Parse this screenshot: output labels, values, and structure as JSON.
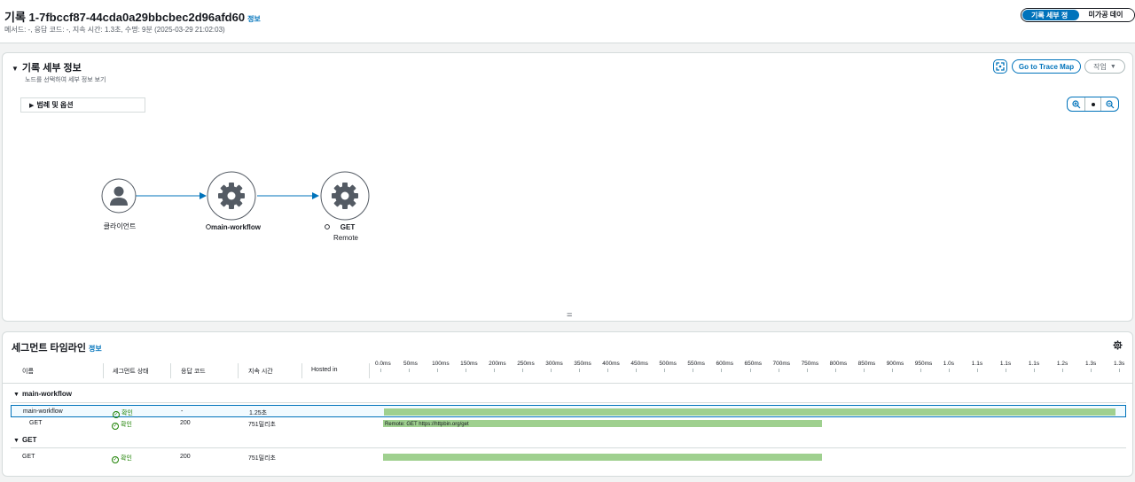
{
  "header": {
    "title": "기록 1-7fbccf87-44cda0a29bbcbec2d96afd60",
    "info": "정보",
    "subtitle": "메서드: -, 응답 코드: -, 지속 시간: 1.3초, 수명: 9분 (2025-03-29 21:02:03)",
    "tabs": [
      "기록 세부 정보",
      "미가공 데이터"
    ]
  },
  "details": {
    "title": "기록 세부 정보",
    "desc": "노드를 선택하여 세부 정보 보기",
    "go_to_trace_map": "Go to Trace Map",
    "actions": "작업",
    "legend_label": "범례 및 옵션",
    "nodes": [
      {
        "label": "클라이언트",
        "sub": ""
      },
      {
        "label": "main-workflow",
        "sub": ""
      },
      {
        "label": "GET",
        "sub": "Remote"
      }
    ],
    "divider": "="
  },
  "timeline": {
    "title": "세그먼트 타임라인",
    "info": "정보",
    "columns": [
      "이름",
      "세그먼트 상태",
      "응답 코드",
      "지속 시간",
      "Hosted in"
    ],
    "ticks": [
      "0.0ms",
      "50ms",
      "100ms",
      "150ms",
      "200ms",
      "250ms",
      "300ms",
      "350ms",
      "400ms",
      "450ms",
      "500ms",
      "550ms",
      "600ms",
      "650ms",
      "700ms",
      "750ms",
      "800ms",
      "850ms",
      "900ms",
      "950ms",
      "1.0s",
      "1.1s",
      "1.1s",
      "1.1s",
      "1.2s",
      "1.3s",
      "1.3s"
    ],
    "groups": [
      {
        "name": "main-workflow",
        "rows": [
          {
            "name": "main-workflow",
            "status": "확인",
            "code": "-",
            "duration": "1.25초",
            "bar_frac": 1.0,
            "bar_label": ""
          },
          {
            "name": "GET",
            "status": "확인",
            "code": "200",
            "duration": "751밀리초",
            "bar_frac": 0.6,
            "bar_label": "Remote: GET https://httpbin.org/get"
          }
        ]
      },
      {
        "name": "GET",
        "rows": [
          {
            "name": "GET",
            "status": "확인",
            "code": "200",
            "duration": "751밀리초",
            "bar_frac": 0.6,
            "bar_label": ""
          }
        ]
      }
    ]
  },
  "colors": {
    "accent": "#0073bb",
    "ok": "#1d8102",
    "bar": "#9fd08f"
  }
}
